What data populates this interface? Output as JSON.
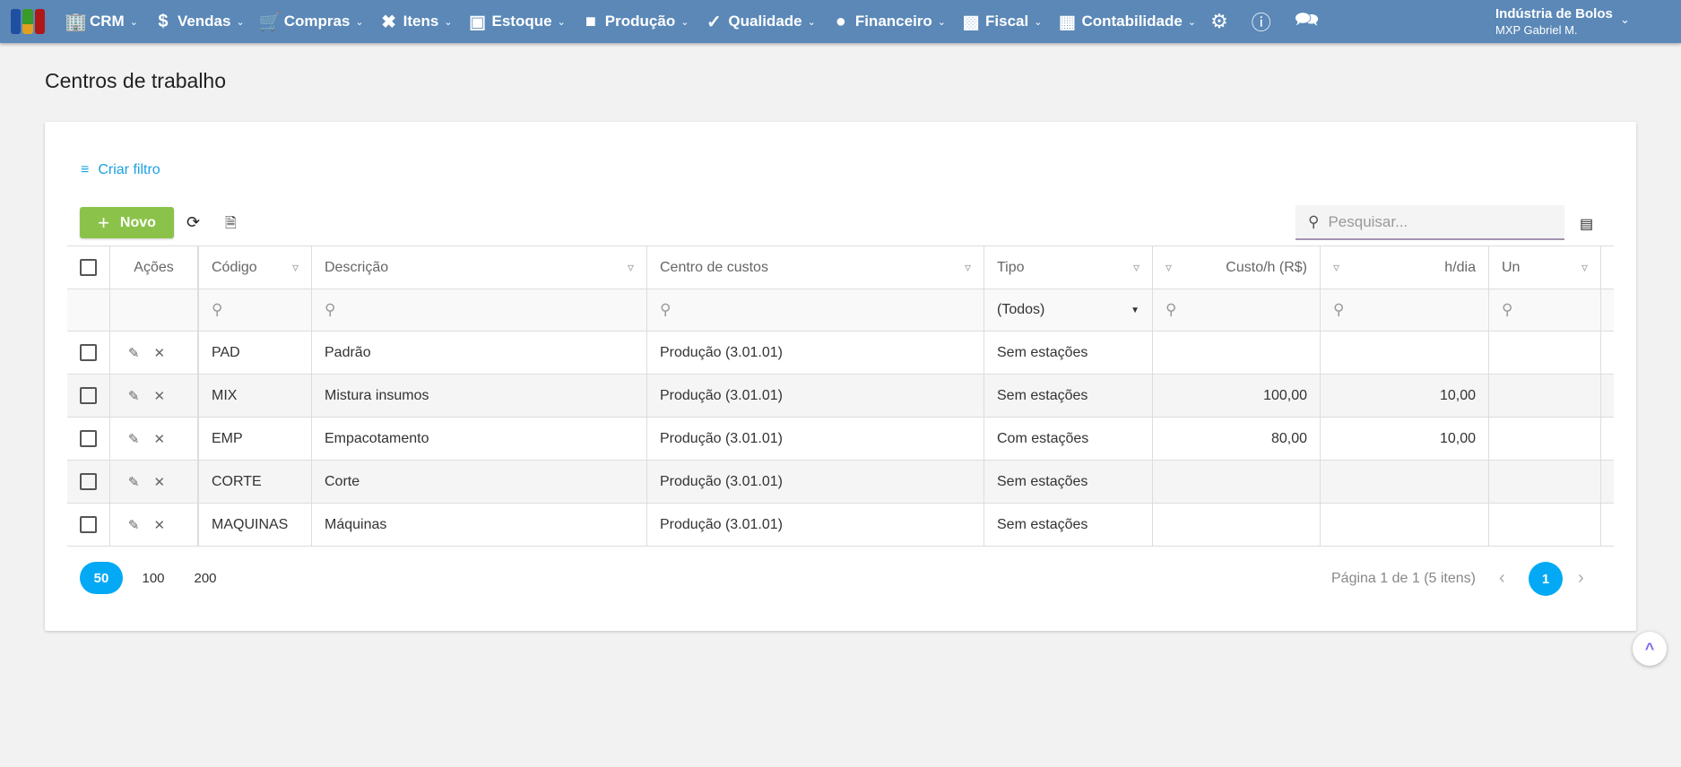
{
  "topbar": {
    "nav": [
      {
        "label": "CRM",
        "icon": "building-user-icon"
      },
      {
        "label": "Vendas",
        "icon": "dollar-circle-icon"
      },
      {
        "label": "Compras",
        "icon": "cart-icon"
      },
      {
        "label": "Itens",
        "icon": "tools-icon"
      },
      {
        "label": "Estoque",
        "icon": "dolly-icon"
      },
      {
        "label": "Produção",
        "icon": "factory-icon"
      },
      {
        "label": "Qualidade",
        "icon": "double-check-icon"
      },
      {
        "label": "Financeiro",
        "icon": "money-bag-icon"
      },
      {
        "label": "Fiscal",
        "icon": "file-check-icon"
      },
      {
        "label": "Contabilidade",
        "icon": "calculator-icon"
      }
    ],
    "company": "Indústria de Bolos",
    "user": "MXP Gabriel M."
  },
  "page": {
    "title": "Centros de trabalho"
  },
  "toolbar": {
    "filter_label": "Criar filtro",
    "new_label": "Novo",
    "search_placeholder": "Pesquisar..."
  },
  "table": {
    "headers": [
      "Ações",
      "Código",
      "Descrição",
      "Centro de custos",
      "Tipo",
      "Custo/h (R$)",
      "h/dia",
      "Un"
    ],
    "tipo_filter": "(Todos)",
    "rows": [
      {
        "codigo": "PAD",
        "descricao": "Padrão",
        "centro": "Produção (3.01.01)",
        "tipo": "Sem estações",
        "custo": "",
        "hdia": "",
        "un": ""
      },
      {
        "codigo": "MIX",
        "descricao": "Mistura insumos",
        "centro": "Produção (3.01.01)",
        "tipo": "Sem estações",
        "custo": "100,00",
        "hdia": "10,00",
        "un": ""
      },
      {
        "codigo": "EMP",
        "descricao": "Empacotamento",
        "centro": "Produção (3.01.01)",
        "tipo": "Com estações",
        "custo": "80,00",
        "hdia": "10,00",
        "un": ""
      },
      {
        "codigo": "CORTE",
        "descricao": "Corte",
        "centro": "Produção (3.01.01)",
        "tipo": "Sem estações",
        "custo": "",
        "hdia": "",
        "un": ""
      },
      {
        "codigo": "MAQUINAS",
        "descricao": "Máquinas",
        "centro": "Produção (3.01.01)",
        "tipo": "Sem estações",
        "custo": "",
        "hdia": "",
        "un": ""
      }
    ]
  },
  "pager": {
    "sizes": [
      "50",
      "100",
      "200"
    ],
    "info": "Página 1 de 1 (5 itens)",
    "current": "1"
  },
  "colors": {
    "topbar": "#5b88b7",
    "accent": "#03a9f4",
    "new_button": "#8bc34a",
    "link": "#1ba1e2"
  }
}
